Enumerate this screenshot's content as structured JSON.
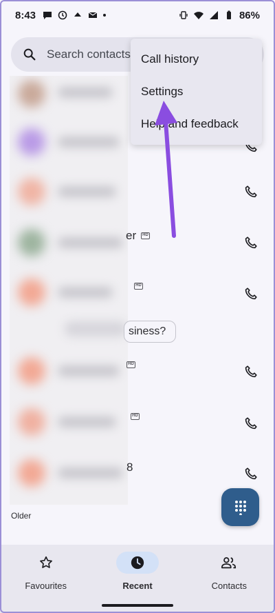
{
  "status_bar": {
    "time": "8:43",
    "battery": "86%"
  },
  "search": {
    "placeholder": "Search contacts a"
  },
  "overflow_menu": {
    "items": [
      {
        "label": "Call history"
      },
      {
        "label": "Settings"
      },
      {
        "label": "Help and feedback"
      }
    ]
  },
  "recents": {
    "partial_rows": [
      {
        "text": "er"
      },
      {
        "text": ""
      },
      {
        "text": "8"
      }
    ],
    "chip_text": "siness?",
    "section_label": "Older"
  },
  "bottom_nav": {
    "tabs": [
      {
        "label": "Favourites",
        "icon": "star-icon",
        "active": false
      },
      {
        "label": "Recent",
        "icon": "clock-icon",
        "active": true
      },
      {
        "label": "Contacts",
        "icon": "people-icon",
        "active": false
      }
    ]
  },
  "colors": {
    "accent": "#2f5d8c",
    "active_tab_pill": "#d3e1f7",
    "annotation_arrow": "#8a4de0"
  }
}
